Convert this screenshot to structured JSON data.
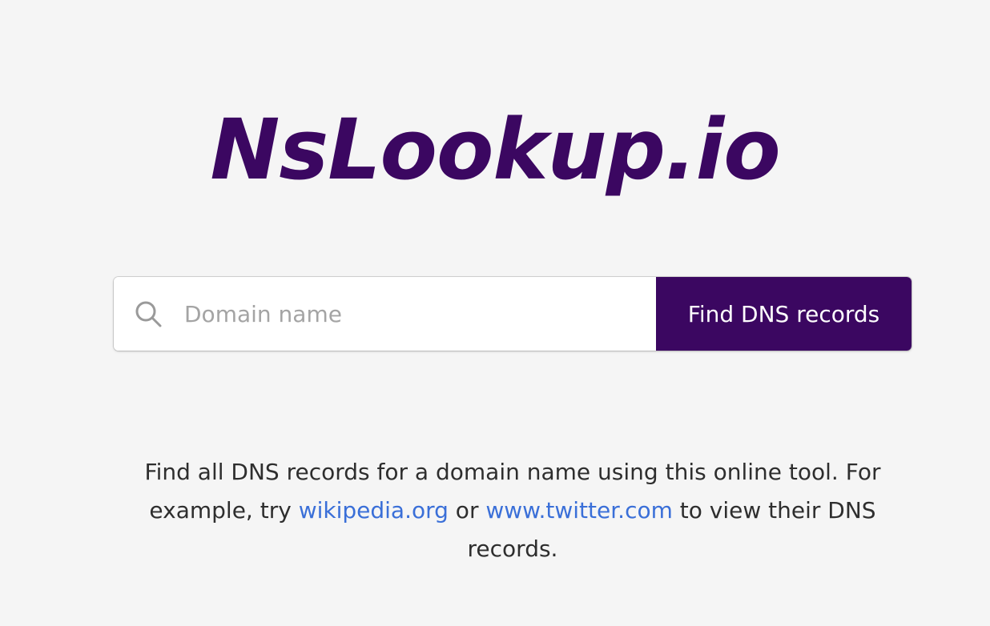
{
  "logo": {
    "text": "NsLookup.io"
  },
  "search": {
    "placeholder": "Domain name",
    "value": "",
    "icon": "search-icon",
    "button_label": "Find DNS records"
  },
  "description": {
    "text_before": "Find all DNS records for a domain name using this online tool. For example, try ",
    "link1": "wikipedia.org",
    "text_middle": " or ",
    "link2": "www.twitter.com",
    "text_after": " to view their DNS records."
  },
  "colors": {
    "brand": "#3b0761",
    "link": "#3a6fd8",
    "background": "#f5f5f5"
  }
}
